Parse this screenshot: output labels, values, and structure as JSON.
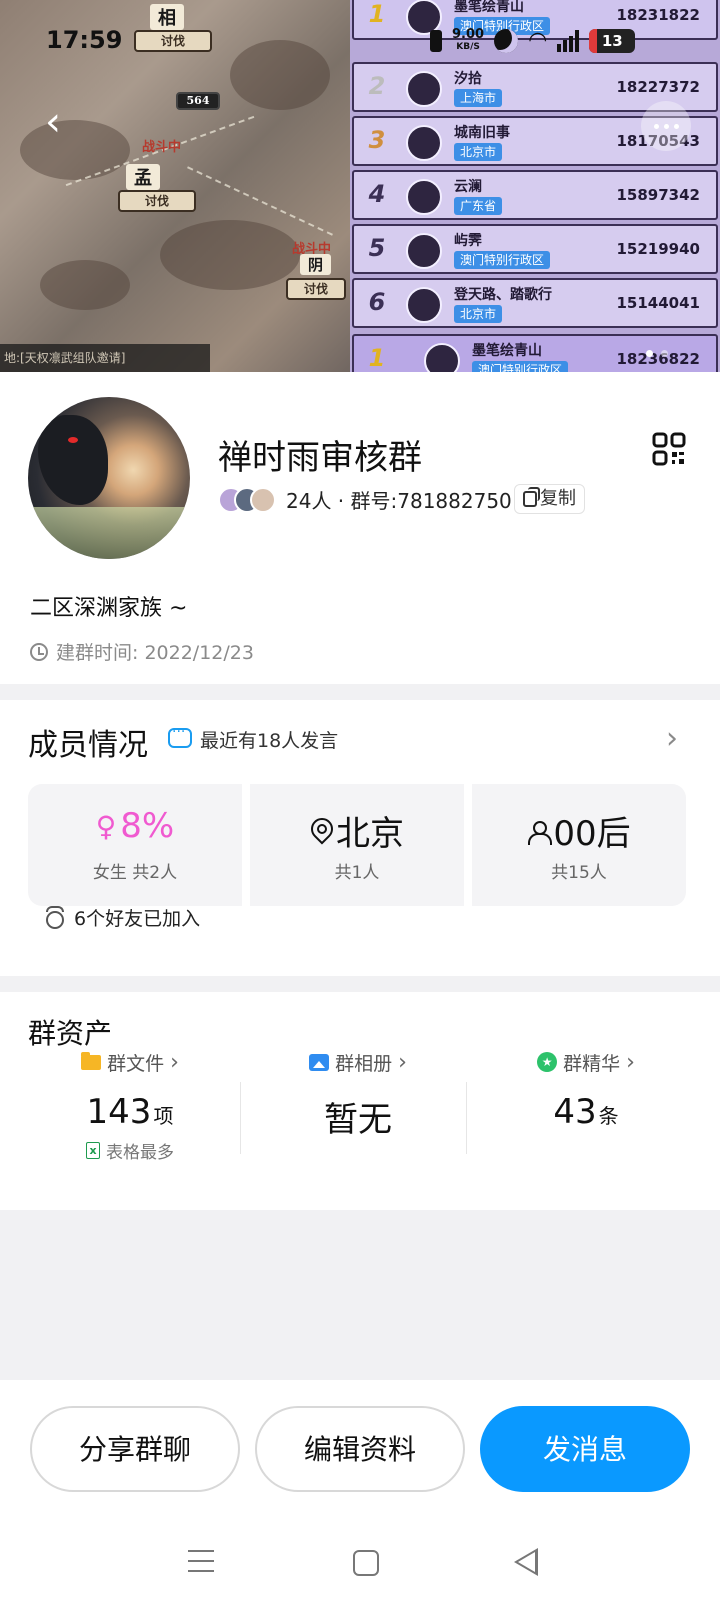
{
  "status_bar": {
    "time": "17:59",
    "net_speed": "9.00",
    "net_unit": "KB/S",
    "battery": "13"
  },
  "banner": {
    "map": {
      "city_top": "相",
      "city_mid": "孟",
      "city_right": "阴",
      "badge_number": "564",
      "fighting": "战斗中",
      "attack": "讨伐",
      "bottom_note": "地:[天权凛武组队邀请]"
    },
    "ranking": [
      {
        "rank": "1",
        "name": "墨笔绘青山",
        "location": "澳门特别行政区",
        "score": "18231822"
      },
      {
        "rank": "2",
        "name": "汐拾",
        "location": "上海市",
        "score": "18227372"
      },
      {
        "rank": "3",
        "name": "城南旧事",
        "location": "北京市",
        "score": "18170543"
      },
      {
        "rank": "4",
        "name": "云澜",
        "location": "广东省",
        "score": "15897342"
      },
      {
        "rank": "5",
        "name": "屿霁",
        "location": "澳门特别行政区",
        "score": "15219940"
      },
      {
        "rank": "6",
        "name": "登天路、踏歌行",
        "location": "北京市",
        "score": "15144041"
      },
      {
        "rank": "1",
        "name": "墨笔绘青山",
        "location": "澳门特别行政区",
        "score": "18236822"
      }
    ]
  },
  "group": {
    "name": "禅时雨审核群",
    "member_info": "24人 · 群号:781882750",
    "copy_label": "复制",
    "description": "二区深渊家族 ~",
    "created_label": "建群时间: 2022/12/23"
  },
  "members": {
    "title": "成员情况",
    "recent_speak": "最近有18人发言",
    "female": {
      "value": "8%",
      "label": "女生 共2人"
    },
    "location": {
      "value": "北京",
      "label": "共1人"
    },
    "age": {
      "value": "00后",
      "label": "共15人"
    },
    "friends_joined": "6个好友已加入"
  },
  "assets": {
    "title": "群资产",
    "files": {
      "label": "群文件",
      "count": "143",
      "unit": "项",
      "sub": "表格最多"
    },
    "album": {
      "label": "群相册",
      "value": "暂无"
    },
    "featured": {
      "label": "群精华",
      "count": "43",
      "unit": "条"
    }
  },
  "actions": {
    "share": "分享群聊",
    "edit": "编辑资料",
    "send": "发消息"
  },
  "colors": {
    "accent": "#0a99ff",
    "female": "#f05ad0"
  }
}
